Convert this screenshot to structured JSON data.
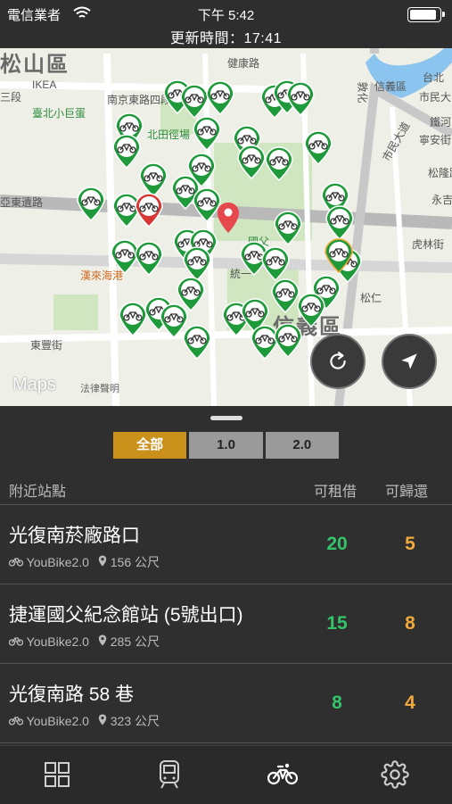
{
  "status_bar": {
    "carrier": "電信業者",
    "time": "下午 5:42",
    "update_text": "更新時間：17:41"
  },
  "map": {
    "district_labels": [
      "松山區",
      "信義區"
    ],
    "labels": [
      "IKEA",
      "臺北小巨蛋",
      "北田徑場",
      "亞東遺路",
      "漢來海港",
      "統一",
      "東豐街",
      "健康路",
      "南京東路四段",
      "三段",
      "寧安街",
      "市民大道",
      "松隆路",
      "永吉",
      "虎林街",
      "信義區",
      "敦化",
      "東豐",
      "台北",
      "鐵河",
      "市民大",
      "國父",
      "松仁"
    ],
    "attribution": "Maps",
    "legal": "法律聲明"
  },
  "sheet": {
    "segments": [
      {
        "label": "全部",
        "active": true
      },
      {
        "label": "1.0",
        "active": false
      },
      {
        "label": "2.0",
        "active": false
      }
    ],
    "headers": {
      "station": "附近站點",
      "rent": "可租借",
      "return": "可歸還"
    },
    "stations": [
      {
        "name": "光復南菸廠路口",
        "type": "YouBike2.0",
        "distance": "156 公尺",
        "rent": "20",
        "return": "5"
      },
      {
        "name": "捷運國父紀念館站 (5號出口)",
        "type": "YouBike2.0",
        "distance": "285 公尺",
        "rent": "15",
        "return": "8"
      },
      {
        "name": "光復南路 58 巷",
        "type": "YouBike2.0",
        "distance": "323 公尺",
        "rent": "8",
        "return": "4"
      }
    ]
  },
  "colors": {
    "accent": "#c9901a",
    "rent": "#34c46a",
    "return": "#f2a93b",
    "pin_green": "#1f9a3a",
    "pin_red": "#d93636"
  }
}
